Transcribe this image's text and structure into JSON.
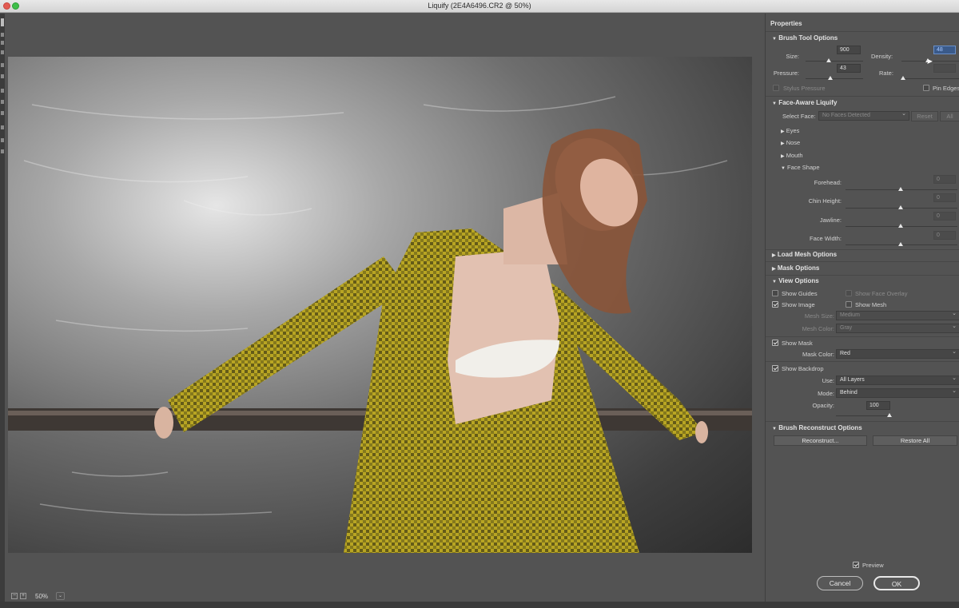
{
  "window": {
    "title": "Liquify (2E4A6496.CR2 @ 50%)"
  },
  "status": {
    "zoom": "50%",
    "zoom_out": "−",
    "zoom_in": "+"
  },
  "properties": {
    "title": "Properties",
    "brush_tool_options": {
      "header": "Brush Tool Options",
      "size_label": "Size:",
      "size_value": "900",
      "density_label": "Density:",
      "density_value": "48",
      "pressure_label": "Pressure:",
      "pressure_value": "43",
      "rate_label": "Rate:",
      "rate_value": "",
      "stylus_pressure_label": "Stylus Pressure",
      "pin_edges_label": "Pin Edges"
    },
    "face_aware": {
      "header": "Face-Aware Liquify",
      "select_face_label": "Select Face:",
      "select_face_value": "No Faces Detected",
      "reset_label": "Reset",
      "all_label": "All",
      "eyes_label": "Eyes",
      "nose_label": "Nose",
      "mouth_label": "Mouth",
      "face_shape_label": "Face Shape",
      "forehead_label": "Forehead:",
      "chin_height_label": "Chin Height:",
      "jawline_label": "Jawline:",
      "face_width_label": "Face Width:",
      "forehead_value": "0",
      "chin_height_value": "0",
      "jawline_value": "0",
      "face_width_value": "0"
    },
    "load_mesh_options": {
      "header": "Load Mesh Options"
    },
    "mask_options": {
      "header": "Mask Options"
    },
    "view_options": {
      "header": "View Options",
      "show_guides_label": "Show Guides",
      "show_face_overlay_label": "Show Face Overlay",
      "show_image_label": "Show Image",
      "show_mesh_label": "Show Mesh",
      "mesh_size_label": "Mesh Size:",
      "mesh_size_value": "Medium",
      "mesh_color_label": "Mesh Color:",
      "mesh_color_value": "Gray",
      "show_mask_label": "Show Mask",
      "mask_color_label": "Mask Color:",
      "mask_color_value": "Red",
      "show_backdrop_label": "Show Backdrop",
      "use_label": "Use:",
      "use_value": "All Layers",
      "mode_label": "Mode:",
      "mode_value": "Behind",
      "opacity_label": "Opacity:",
      "opacity_value": "100"
    },
    "brush_reconstruct": {
      "header": "Brush Reconstruct Options",
      "reconstruct_label": "Reconstruct...",
      "restore_all_label": "Restore All"
    }
  },
  "footer": {
    "preview_label": "Preview",
    "cancel_label": "Cancel",
    "ok_label": "OK"
  }
}
